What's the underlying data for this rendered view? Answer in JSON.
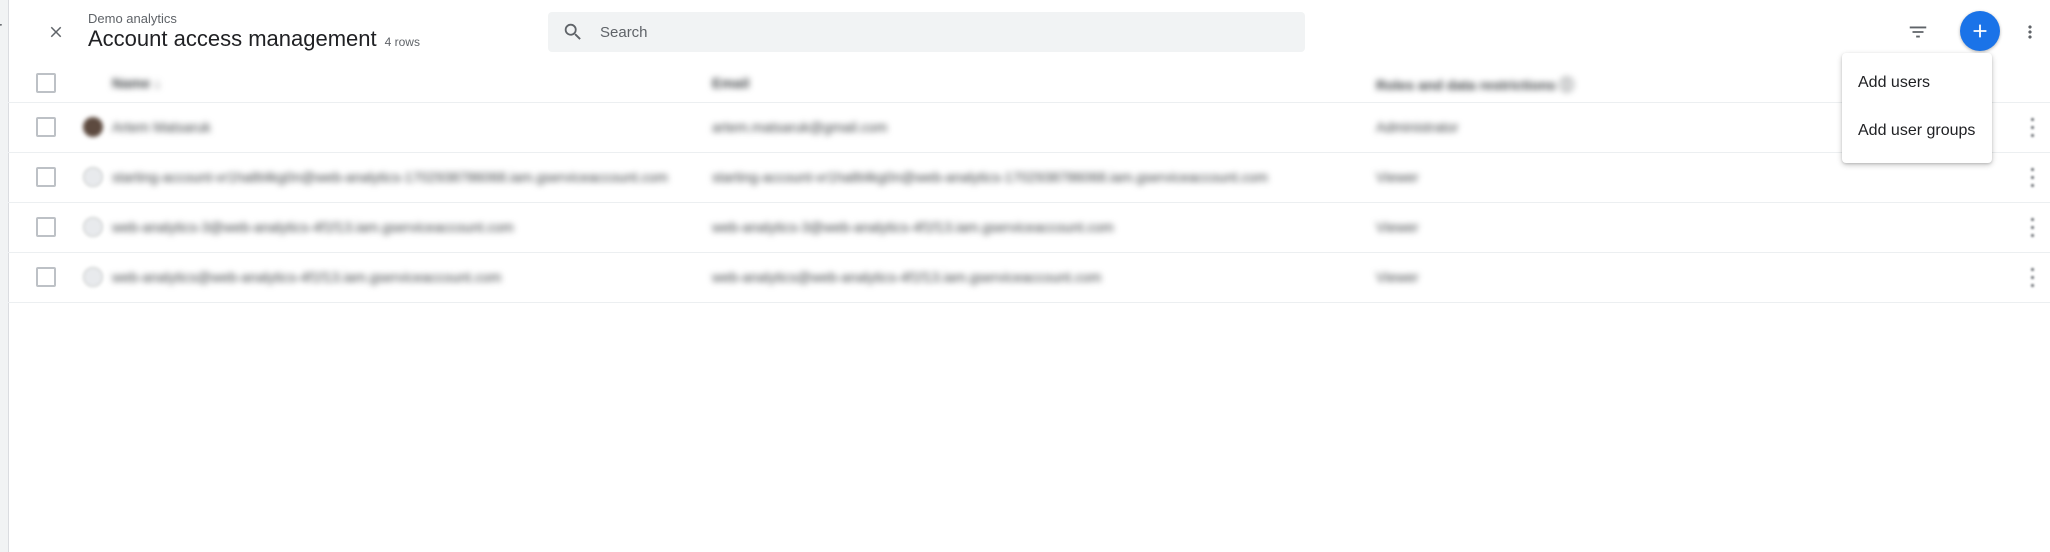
{
  "header": {
    "breadcrumb": "Demo analytics",
    "title": "Account access management",
    "row_count": "4 rows"
  },
  "search": {
    "placeholder": "Search",
    "value": ""
  },
  "icons": {
    "close": "close-icon",
    "search": "search-icon",
    "filter": "filter-icon",
    "add": "plus-icon",
    "more": "more-vert-icon",
    "sort": "arrow-down-icon",
    "help": "help-icon"
  },
  "colors": {
    "accent": "#1a73e8",
    "search_bg": "#f1f3f4"
  },
  "table": {
    "columns": {
      "name": "Name",
      "email": "Email",
      "roles": "Roles and data restrictions"
    },
    "rows": [
      {
        "name": "Artem Matsaruk",
        "email": "artem.matsaruk@gmail.com",
        "role": "Administrator"
      },
      {
        "name": "starting-account-vr1ha8t4kg0n@web-analytics-1702938786068.iam.gserviceaccount.com",
        "email": "starting-account-vr1ha8t4kg0n@web-analytics-1702938786068.iam.gserviceaccount.com",
        "role": "Viewer"
      },
      {
        "name": "web-analytics-3@web-analytics-4f1f13.iam.gserviceaccount.com",
        "email": "web-analytics-3@web-analytics-4f1f13.iam.gserviceaccount.com",
        "role": "Viewer"
      },
      {
        "name": "web-analytics@web-analytics-4f1f13.iam.gserviceaccount.com",
        "email": "web-analytics@web-analytics-4f1f13.iam.gserviceaccount.com",
        "role": "Viewer"
      }
    ]
  },
  "menu": {
    "items": [
      {
        "label": "Add users"
      },
      {
        "label": "Add user groups"
      }
    ]
  },
  "left_panel": {
    "fragment": "r"
  }
}
